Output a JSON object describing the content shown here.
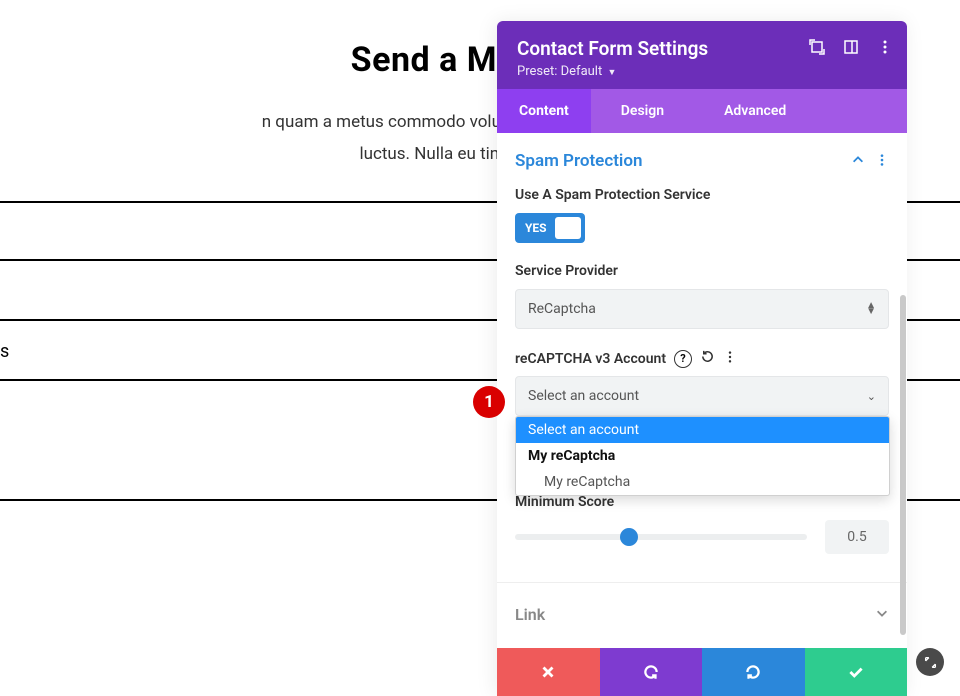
{
  "page": {
    "title": "Send a Message",
    "desc_line1": "n quam a metus commodo volutpat. Vivamus non urna sit",
    "desc_line2": "luctus. Nulla eu tincidunt lectus.",
    "field3_partial": "s"
  },
  "panel": {
    "title": "Contact Form Settings",
    "preset_label": "Preset:",
    "preset_value": "Default"
  },
  "tabs": {
    "content": "Content",
    "design": "Design",
    "advanced": "Advanced"
  },
  "spam": {
    "section_title": "Spam Protection",
    "use_service_label": "Use A Spam Protection Service",
    "toggle_text": "YES",
    "provider_label": "Service Provider",
    "provider_value": "ReCaptcha",
    "account_label": "reCAPTCHA v3 Account",
    "account_placeholder": "Select an account",
    "dropdown": {
      "opt1": "Select an account",
      "opt2": "My reCaptcha",
      "opt3": "My reCaptcha"
    },
    "min_score_label": "Minimum Score",
    "min_score_value": "0.5"
  },
  "link_section": {
    "title": "Link"
  },
  "callout": {
    "num": "1"
  }
}
